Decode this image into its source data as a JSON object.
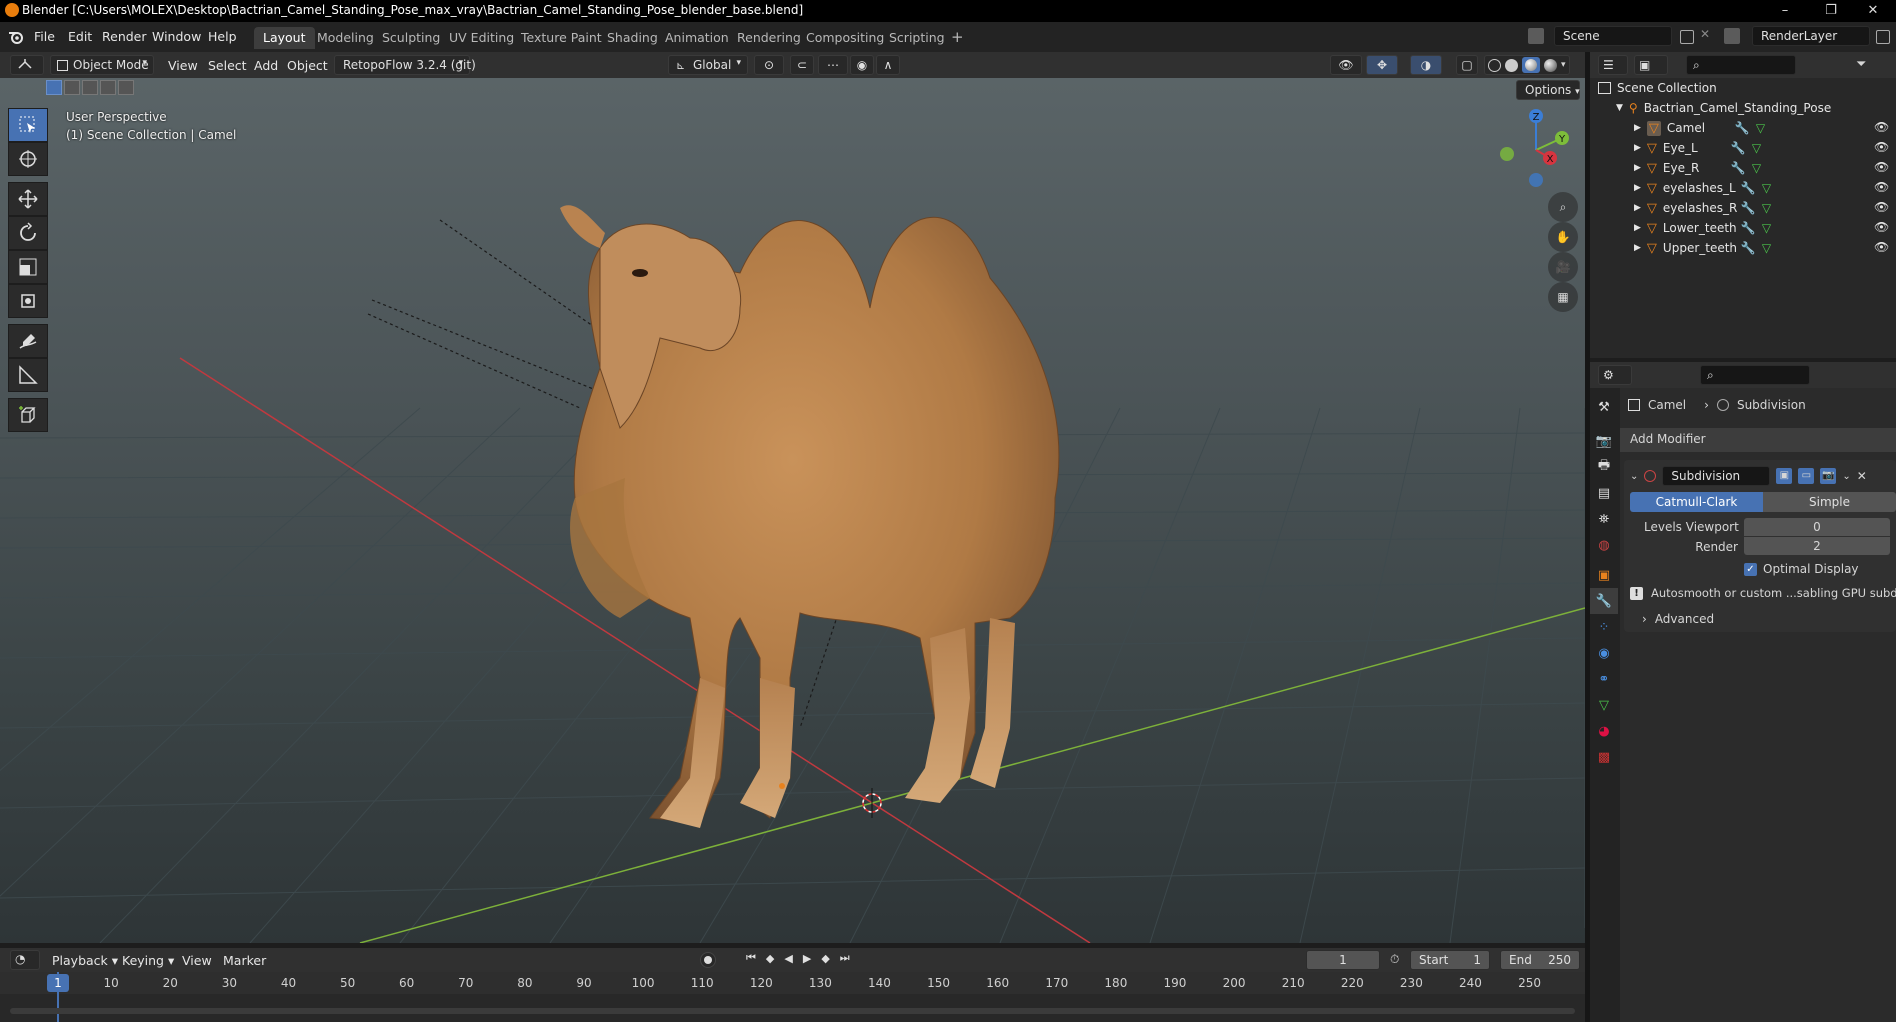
{
  "window": {
    "title": "Blender [C:\\Users\\MOLEX\\Desktop\\Bactrian_Camel_Standing_Pose_max_vray\\Bactrian_Camel_Standing_Pose_blender_base.blend]",
    "minimize": "–",
    "restore": "❐",
    "close": "✕"
  },
  "menu": [
    "File",
    "Edit",
    "Render",
    "Window",
    "Help"
  ],
  "workspaces": [
    {
      "label": "Layout",
      "active": true
    },
    {
      "label": "Modeling"
    },
    {
      "label": "Sculpting"
    },
    {
      "label": "UV Editing"
    },
    {
      "label": "Texture Paint"
    },
    {
      "label": "Shading"
    },
    {
      "label": "Animation"
    },
    {
      "label": "Rendering"
    },
    {
      "label": "Compositing"
    },
    {
      "label": "Scripting"
    }
  ],
  "add_workspace": "+",
  "scene": {
    "name": "Scene",
    "render_layer": "RenderLayer"
  },
  "viewport_header": {
    "mode": "Object Mode",
    "menus": [
      "View",
      "Select",
      "Add",
      "Object"
    ],
    "addon": "RetopoFlow 3.2.4 (git)",
    "transform": "Global",
    "options": "Options"
  },
  "viewport": {
    "perspective": "User Perspective",
    "collection": "(1) Scene Collection | Camel",
    "gizmo": {
      "z": "Z",
      "y": "Y",
      "x": "X"
    }
  },
  "timeline": {
    "menus": [
      "Playback",
      "Keying",
      "View",
      "Marker"
    ],
    "current_frame": "1",
    "start_label": "Start",
    "start": "1",
    "end_label": "End",
    "end": "250",
    "ticks": [
      "1",
      "10",
      "20",
      "30",
      "40",
      "50",
      "60",
      "70",
      "80",
      "90",
      "100",
      "110",
      "120",
      "130",
      "140",
      "150",
      "160",
      "170",
      "180",
      "190",
      "200",
      "210",
      "220",
      "230",
      "240",
      "250"
    ]
  },
  "outliner": {
    "root": "Scene Collection",
    "collection": "Bactrian_Camel_Standing_Pose",
    "objects": [
      "Camel",
      "Eye_L",
      "Eye_R",
      "eyelashes_L",
      "eyelashes_R",
      "Lower_teeth",
      "Upper_teeth"
    ]
  },
  "properties": {
    "breadcrumb_object": "Camel",
    "breadcrumb_modifier": "Subdivision",
    "add_modifier": "Add Modifier",
    "modifier_name": "Subdivision",
    "type_a": "Catmull-Clark",
    "type_b": "Simple",
    "levels_viewport_label": "Levels Viewport",
    "levels_viewport": "0",
    "render_label": "Render",
    "render": "2",
    "optimal_display": "Optimal Display",
    "warning": "Autosmooth or custom ...sabling GPU subdivision",
    "advanced": "Advanced"
  },
  "colors": {
    "accent": "#4772b3",
    "x_axis": "#d6343f",
    "y_axis": "#7dbd3a",
    "z_axis": "#3b7ed6",
    "object_orange": "#e8821e"
  }
}
